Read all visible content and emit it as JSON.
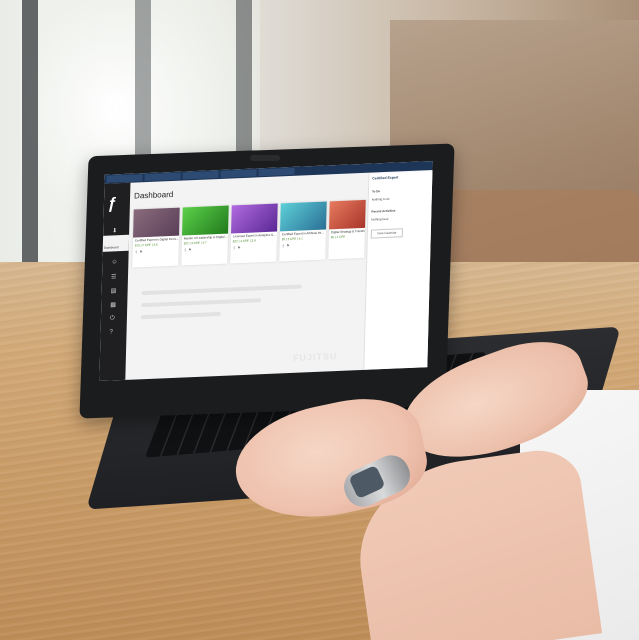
{
  "scene": {
    "description_colors": {
      "table": "#cf9f6a",
      "laptop": "#1b1c1e",
      "skin": "#f0c6b2",
      "sleeve": "#f2f2f2"
    }
  },
  "laptop": {
    "brand": "FUJITSU"
  },
  "app": {
    "page_title": "Dashboard",
    "nav_active_label": "Dashboard",
    "tabs": [
      "",
      "",
      "",
      "",
      "",
      ""
    ],
    "cards": [
      {
        "title": "Certified Expert in Digital Innov...",
        "sub": "$10 | 2 CPE | 3.6",
        "color": "#6a4a6e"
      },
      {
        "title": "Master of Leadership in Digital ...",
        "sub": "$22 | 3 CPE | 4.7",
        "color": "#3e9a2c"
      },
      {
        "title": "Licensed Expert in Analytics &...",
        "sub": "$22 | 4 CPE | 3.9",
        "color": "#7d3fb0"
      },
      {
        "title": "Certified Expert in Artificial Int...",
        "sub": "$5 | 5 CPE | 4.1",
        "color": "#3a8fb0"
      },
      {
        "title": "Digital Strategy & Transformat...",
        "sub": "$5 | 2 CPE",
        "color": "#c85a46"
      }
    ],
    "panel": {
      "header": "Certified Expert",
      "lines": [
        "To Do",
        "Nothing to do",
        "Recent Activities",
        "Nothing here"
      ],
      "button": "View Calendar"
    }
  }
}
